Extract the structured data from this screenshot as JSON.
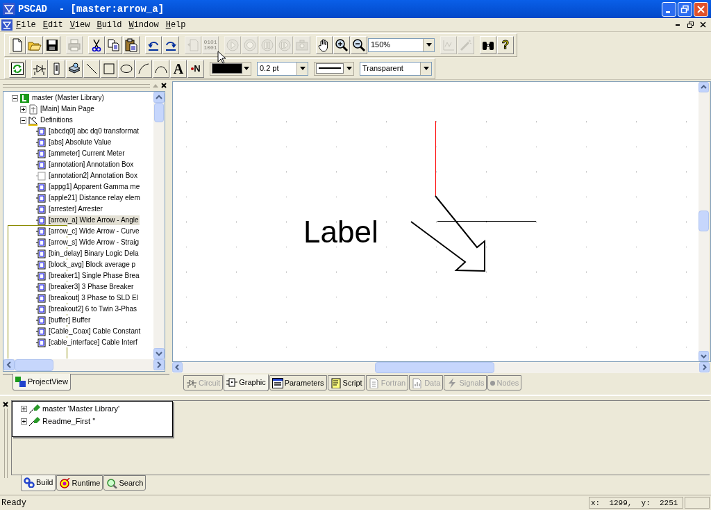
{
  "window": {
    "title": "PSCAD  - [master:arrow_a]"
  },
  "menu": [
    "File",
    "Edit",
    "View",
    "Build",
    "Window",
    "Help"
  ],
  "toolbar1": [
    {
      "kind": "new",
      "disabled": false
    },
    {
      "kind": "open",
      "disabled": false
    },
    {
      "kind": "save",
      "disabled": false
    },
    {
      "kind": "sep"
    },
    {
      "kind": "print",
      "disabled": true
    },
    {
      "kind": "sep"
    },
    {
      "kind": "cut",
      "disabled": false
    },
    {
      "kind": "copy",
      "disabled": false
    },
    {
      "kind": "paste",
      "disabled": false
    },
    {
      "kind": "sep"
    },
    {
      "kind": "undo",
      "disabled": false
    },
    {
      "kind": "redo",
      "disabled": false
    },
    {
      "kind": "sep"
    },
    {
      "kind": "function",
      "disabled": true
    },
    {
      "kind": "binary",
      "lines": [
        "0101",
        "1001"
      ],
      "disabled": true
    },
    {
      "kind": "sep"
    },
    {
      "kind": "play",
      "disabled": true
    },
    {
      "kind": "stop",
      "disabled": true
    },
    {
      "kind": "pause",
      "disabled": true
    },
    {
      "kind": "step",
      "disabled": true
    },
    {
      "kind": "camera",
      "disabled": true
    },
    {
      "kind": "sep"
    },
    {
      "kind": "hand",
      "disabled": false
    },
    {
      "kind": "zoom-in",
      "disabled": false
    },
    {
      "kind": "zoom-out",
      "disabled": false
    },
    {
      "kind": "zoom-combo",
      "value": "150%"
    },
    {
      "kind": "sep"
    },
    {
      "kind": "wave",
      "disabled": true
    },
    {
      "kind": "wand",
      "disabled": true
    },
    {
      "kind": "sep"
    },
    {
      "kind": "binoculars",
      "disabled": false
    },
    {
      "kind": "help",
      "glyph": "?",
      "disabled": false
    }
  ],
  "toolbar2": [
    {
      "kind": "refresh",
      "disabled": false
    },
    {
      "kind": "sep"
    },
    {
      "kind": "component",
      "disabled": false
    },
    {
      "kind": "probe",
      "disabled": false
    },
    {
      "kind": "layers",
      "disabled": false
    },
    {
      "kind": "line",
      "disabled": false
    },
    {
      "kind": "rect",
      "disabled": false
    },
    {
      "kind": "ellipse",
      "disabled": false
    },
    {
      "kind": "arc",
      "disabled": false
    },
    {
      "kind": "curve",
      "disabled": false
    },
    {
      "kind": "text-tool",
      "glyph": "A",
      "disabled": false
    },
    {
      "kind": "node-label",
      "glyph": "N",
      "disabled": false
    },
    {
      "kind": "sep"
    },
    {
      "kind": "color-combo",
      "color": "#000000"
    },
    {
      "kind": "sep"
    },
    {
      "kind": "weight-combo",
      "value": "0.2 pt"
    },
    {
      "kind": "sep"
    },
    {
      "kind": "line-combo"
    },
    {
      "kind": "sep"
    },
    {
      "kind": "fill-combo",
      "value": "Transparent"
    }
  ],
  "tree": [
    {
      "label": "master (Master Library)",
      "kind": "library",
      "expanded": true,
      "selected": false,
      "children": [
        {
          "label": "[Main] Main Page",
          "kind": "page",
          "expanded": false,
          "selected": false
        },
        {
          "label": "Definitions",
          "kind": "folder",
          "expanded": true,
          "selected": false,
          "children": [
            {
              "label": "[abcdq0] abc dq0 transformat",
              "kind": "definition",
              "selected": false
            },
            {
              "label": "[abs] Absolute Value",
              "kind": "definition",
              "selected": false
            },
            {
              "label": "[ammeter] Current Meter",
              "kind": "definition",
              "selected": false
            },
            {
              "label": "[annotation] Annotation Box",
              "kind": "definition",
              "selected": false
            },
            {
              "label": "[annotation2] Annotation Box",
              "kind": "blank",
              "selected": false
            },
            {
              "label": "[appg1] Apparent Gamma me",
              "kind": "definition",
              "selected": false
            },
            {
              "label": "[apple21] Distance relay elem",
              "kind": "definition",
              "selected": false
            },
            {
              "label": "[arrester] Arrester",
              "kind": "definition",
              "selected": false
            },
            {
              "label": "[arrow_a] Wide Arrow - Angle",
              "kind": "definition",
              "selected": true
            },
            {
              "label": "[arrow_c] Wide Arrow - Curve",
              "kind": "definition",
              "selected": false
            },
            {
              "label": "[arrow_s] Wide Arrow - Straig",
              "kind": "definition",
              "selected": false
            },
            {
              "label": "[bin_delay] Binary Logic Dela",
              "kind": "definition",
              "selected": false
            },
            {
              "label": "[block_avg] Block average p",
              "kind": "definition",
              "selected": false
            },
            {
              "label": "[breaker1] Single Phase Brea",
              "kind": "definition",
              "selected": false
            },
            {
              "label": "[breaker3] 3 Phase Breaker",
              "kind": "definition",
              "selected": false
            },
            {
              "label": "[breakout] 3 Phase to SLD El",
              "kind": "definition",
              "selected": false
            },
            {
              "label": "[breakout2] 6 to Twin 3-Phas",
              "kind": "definition",
              "selected": false
            },
            {
              "label": "[buffer] Buffer",
              "kind": "definition",
              "selected": false
            },
            {
              "label": "[Cable_Coax] Cable Constant",
              "kind": "definition",
              "selected": false
            },
            {
              "label": "[cable_interface] Cable Interf",
              "kind": "definition",
              "selected": false
            }
          ]
        }
      ]
    }
  ],
  "left_tabs": [
    {
      "label": "ProjectView",
      "selected": true
    }
  ],
  "canvas": {
    "label": "Label"
  },
  "editor_tabs": [
    {
      "label": "Circuit",
      "kind": "circuit",
      "selected": false,
      "disabled": true
    },
    {
      "label": "Graphic",
      "kind": "graphic",
      "selected": true,
      "disabled": false
    },
    {
      "label": "Parameters",
      "kind": "parameters",
      "selected": false,
      "disabled": false
    },
    {
      "label": "Script",
      "kind": "script",
      "selected": false,
      "disabled": false
    },
    {
      "label": "Fortran",
      "kind": "fortran",
      "selected": false,
      "disabled": true
    },
    {
      "label": "Data",
      "kind": "data",
      "selected": false,
      "disabled": true
    },
    {
      "label": "Signals",
      "kind": "signals",
      "selected": false,
      "disabled": true
    },
    {
      "label": "Nodes",
      "kind": "nodes",
      "selected": false,
      "disabled": true
    }
  ],
  "workspace": [
    {
      "label": "master 'Master Library'",
      "expanded": false
    },
    {
      "label": "Readme_First ''",
      "expanded": false
    }
  ],
  "bottom_tabs": [
    {
      "label": "Build",
      "kind": "build",
      "selected": true
    },
    {
      "label": "Runtime",
      "kind": "runtime",
      "selected": false
    },
    {
      "label": "Search",
      "kind": "search",
      "selected": false
    }
  ],
  "status_bar": {
    "message": "Ready",
    "coordinates": "x:  1299,  y:  2251"
  }
}
